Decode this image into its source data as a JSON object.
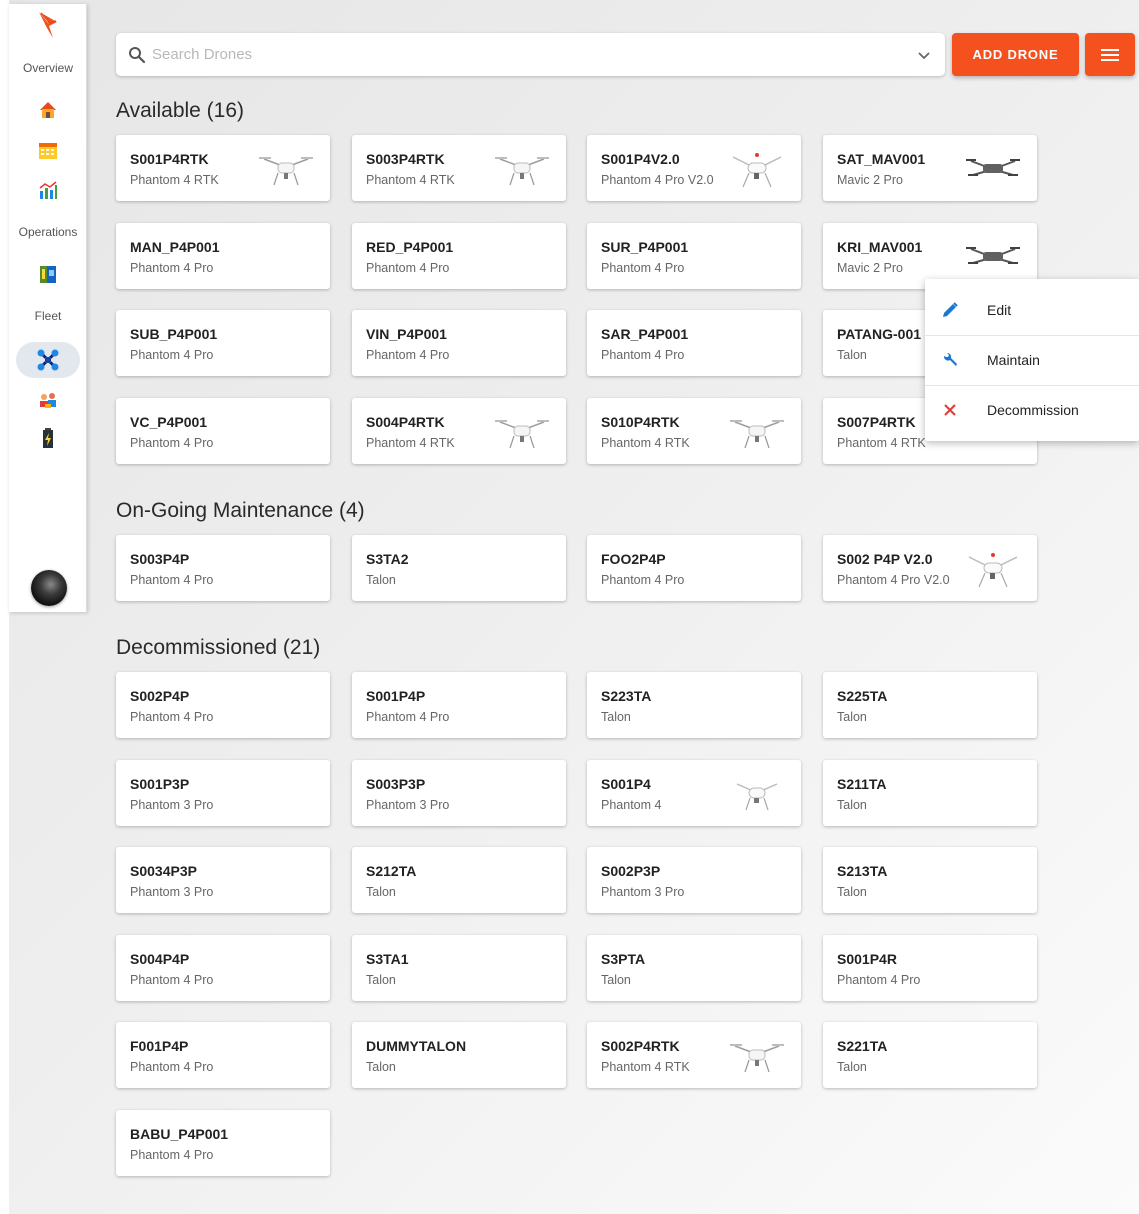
{
  "sidebar": {
    "sections": [
      {
        "label": "Overview"
      },
      {
        "label": "Operations"
      },
      {
        "label": "Fleet"
      }
    ],
    "icons": [
      "home-icon",
      "calendar-icon",
      "analytics-icon",
      "logbook-icon",
      "drone-icon",
      "pilots-icon",
      "battery-icon"
    ]
  },
  "search": {
    "placeholder": "Search Drones"
  },
  "toolbar": {
    "add_label": "ADD DRONE"
  },
  "colors": {
    "accent": "#f4511e",
    "edit": "#1976d2",
    "maintain": "#1976d2",
    "decommission": "#e53935"
  },
  "available": {
    "title": "Available (16)",
    "drones": [
      {
        "name": "S001P4RTK",
        "model": "Phantom 4 RTK",
        "image": "phantom-rtk"
      },
      {
        "name": "S003P4RTK",
        "model": "Phantom 4 RTK",
        "image": "phantom-rtk"
      },
      {
        "name": "S001P4V2.0",
        "model": "Phantom 4 Pro V2.0",
        "image": "phantom-v2"
      },
      {
        "name": "SAT_MAV001",
        "model": "Mavic 2 Pro",
        "image": "mavic"
      },
      {
        "name": "MAN_P4P001",
        "model": "Phantom 4 Pro",
        "image": ""
      },
      {
        "name": "RED_P4P001",
        "model": "Phantom 4 Pro",
        "image": ""
      },
      {
        "name": "SUR_P4P001",
        "model": "Phantom 4 Pro",
        "image": ""
      },
      {
        "name": "KRI_MAV001",
        "model": "Mavic 2 Pro",
        "image": "mavic"
      },
      {
        "name": "SUB_P4P001",
        "model": "Phantom 4 Pro",
        "image": ""
      },
      {
        "name": "VIN_P4P001",
        "model": "Phantom 4 Pro",
        "image": ""
      },
      {
        "name": "SAR_P4P001",
        "model": "Phantom 4 Pro",
        "image": ""
      },
      {
        "name": "PATANG-001",
        "model": "Talon",
        "image": ""
      },
      {
        "name": "VC_P4P001",
        "model": "Phantom 4 Pro",
        "image": ""
      },
      {
        "name": "S004P4RTK",
        "model": "Phantom 4 RTK",
        "image": "phantom-rtk"
      },
      {
        "name": "S010P4RTK",
        "model": "Phantom 4 RTK",
        "image": "phantom-rtk"
      },
      {
        "name": "S007P4RTK",
        "model": "Phantom 4 RTK",
        "image": ""
      }
    ]
  },
  "maintenance": {
    "title": "On-Going Maintenance (4)",
    "drones": [
      {
        "name": "S003P4P",
        "model": "Phantom 4 Pro",
        "image": ""
      },
      {
        "name": "S3TA2",
        "model": "Talon",
        "image": ""
      },
      {
        "name": "FOO2P4P",
        "model": "Phantom 4 Pro",
        "image": ""
      },
      {
        "name": "S002 P4P V2.0",
        "model": "Phantom 4 Pro V2.0",
        "image": "phantom-v2"
      }
    ]
  },
  "decommissioned": {
    "title": "Decommissioned (21)",
    "drones": [
      {
        "name": "S002P4P",
        "model": "Phantom 4 Pro",
        "image": ""
      },
      {
        "name": "S001P4P",
        "model": "Phantom 4 Pro",
        "image": ""
      },
      {
        "name": "S223TA",
        "model": "Talon",
        "image": ""
      },
      {
        "name": "S225TA",
        "model": "Talon",
        "image": ""
      },
      {
        "name": "S001P3P",
        "model": "Phantom 3 Pro",
        "image": ""
      },
      {
        "name": "S003P3P",
        "model": "Phantom 3 Pro",
        "image": ""
      },
      {
        "name": "S001P4",
        "model": "Phantom 4",
        "image": "phantom"
      },
      {
        "name": "S211TA",
        "model": "Talon",
        "image": ""
      },
      {
        "name": "S0034P3P",
        "model": "Phantom 3 Pro",
        "image": ""
      },
      {
        "name": "S212TA",
        "model": "Talon",
        "image": ""
      },
      {
        "name": "S002P3P",
        "model": "Phantom 3 Pro",
        "image": ""
      },
      {
        "name": "S213TA",
        "model": "Talon",
        "image": ""
      },
      {
        "name": "S004P4P",
        "model": "Phantom 4 Pro",
        "image": ""
      },
      {
        "name": "S3TA1",
        "model": "Talon",
        "image": ""
      },
      {
        "name": "S3PTA",
        "model": "Talon",
        "image": ""
      },
      {
        "name": "S001P4R",
        "model": "Phantom 4 Pro",
        "image": ""
      },
      {
        "name": "F001P4P",
        "model": "Phantom 4 Pro",
        "image": ""
      },
      {
        "name": "DUMMYTALON",
        "model": "Talon",
        "image": ""
      },
      {
        "name": "S002P4RTK",
        "model": "Phantom 4 RTK",
        "image": "phantom-rtk"
      },
      {
        "name": "S221TA",
        "model": "Talon",
        "image": ""
      },
      {
        "name": "BABU_P4P001",
        "model": "Phantom 4 Pro",
        "image": ""
      }
    ]
  },
  "context_menu": {
    "items": [
      {
        "label": "Edit",
        "icon": "pencil-icon"
      },
      {
        "label": "Maintain",
        "icon": "wrench-icon"
      },
      {
        "label": "Decommission",
        "icon": "close-icon"
      }
    ]
  }
}
